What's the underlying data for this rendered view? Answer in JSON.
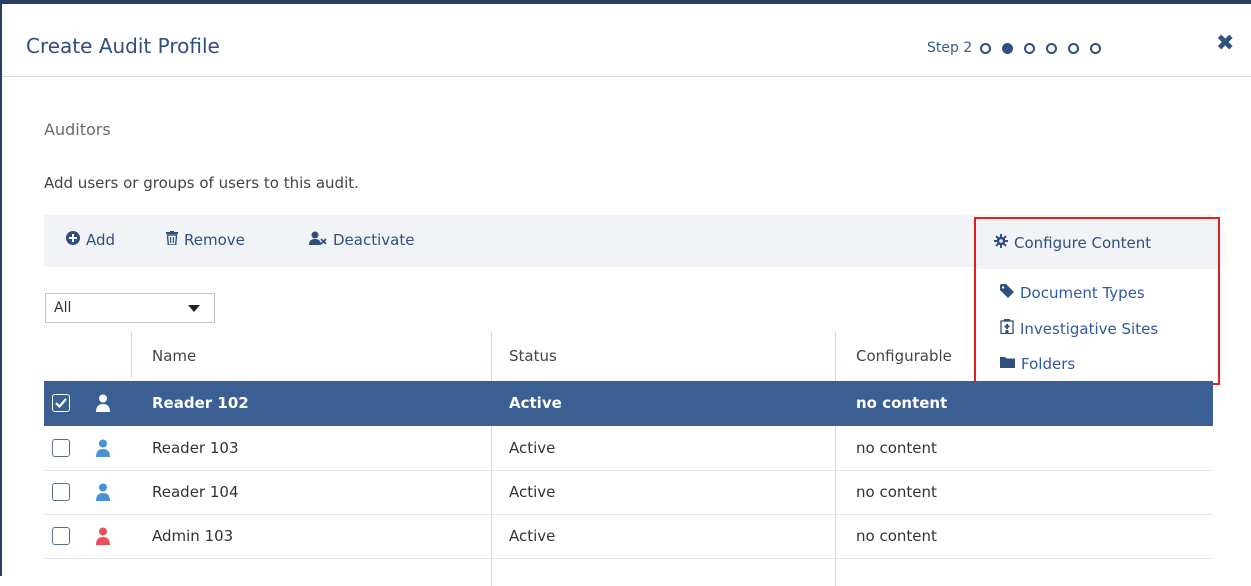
{
  "dialog": {
    "title": "Create Audit Profile",
    "step_label": "Step 2",
    "steps_total": 6,
    "current_step": 2,
    "close_icon": "close-icon"
  },
  "section": {
    "title": "Auditors",
    "description": "Add users or groups of users to this audit."
  },
  "toolbar": {
    "add_label": "Add",
    "remove_label": "Remove",
    "deactivate_label": "Deactivate",
    "configure_label": "Configure Content"
  },
  "configure_menu": {
    "items": [
      {
        "label": "Document Types",
        "icon": "tag-icon"
      },
      {
        "label": "Investigative Sites",
        "icon": "building-icon"
      },
      {
        "label": "Folders",
        "icon": "folder-icon"
      }
    ]
  },
  "filter": {
    "value": "All"
  },
  "table": {
    "columns": [
      "Name",
      "Status",
      "Configurable"
    ],
    "rows": [
      {
        "name": "Reader 102",
        "status": "Active",
        "content": "no content",
        "checked": true,
        "role_color": "#ffffff"
      },
      {
        "name": "Reader 103",
        "status": "Active",
        "content": "no content",
        "checked": false,
        "role_color": "#4a90d9"
      },
      {
        "name": "Reader 104",
        "status": "Active",
        "content": "no content",
        "checked": false,
        "role_color": "#4a90d9"
      },
      {
        "name": "Admin 103",
        "status": "Active",
        "content": "no content",
        "checked": false,
        "role_color": "#e8505b"
      }
    ]
  },
  "colors": {
    "brand": "#2f4f7d",
    "selected_row": "#3b5f93",
    "highlight_border": "#e02020"
  }
}
